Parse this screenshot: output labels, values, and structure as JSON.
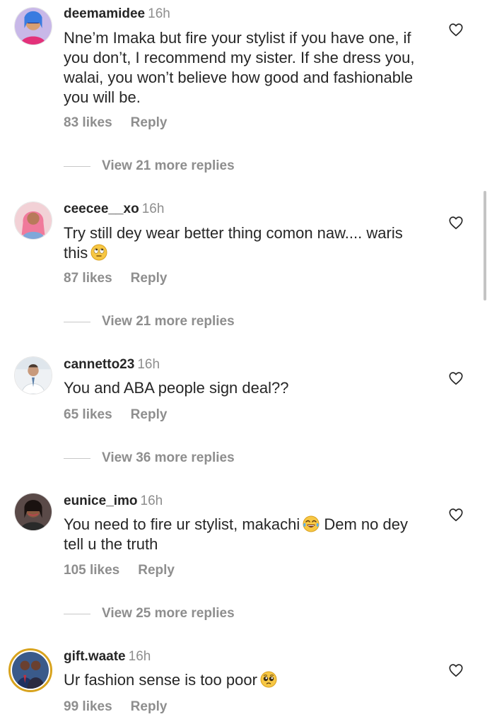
{
  "comments": [
    {
      "username": "deemamidee",
      "time": "16h",
      "text": "Nne’m Imaka but fire your stylist if you have one, if you don’t, I recommend my sister. If she dress you, walai, you won’t believe how good and fashionable you will be.",
      "likes": "83 likes",
      "reply_label": "Reply",
      "view_more": "View 21 more replies"
    },
    {
      "username": "ceecee__xo",
      "time": "16h",
      "text": "Try still dey wear better thing comon naw.... waris this",
      "emoji": "face-with-rolling-eyes",
      "likes": "87 likes",
      "reply_label": "Reply",
      "view_more": "View 21 more replies"
    },
    {
      "username": "cannetto23",
      "time": "16h",
      "text": "You and ABA people sign deal??",
      "likes": "65 likes",
      "reply_label": "Reply",
      "view_more": "View 36 more replies"
    },
    {
      "username": "eunice_imo",
      "time": "16h",
      "text_before_emoji": "You need to fire ur stylist, makachi",
      "emoji": "face-with-tears-of-joy",
      "text_after_emoji": " Dem no dey tell u the truth",
      "likes": "105 likes",
      "reply_label": "Reply",
      "view_more": "View 25 more replies"
    },
    {
      "username": "gift.waate",
      "time": "16h",
      "text": "Ur fashion sense is too poor",
      "emoji": "pleading-face",
      "likes": "99 likes",
      "reply_label": "Reply"
    }
  ],
  "icons": {
    "like": "heart-outline-icon"
  },
  "colors": {
    "primary_text": "#262626",
    "secondary_text": "#8e8e8e",
    "story_ring": "#d8a31e"
  }
}
